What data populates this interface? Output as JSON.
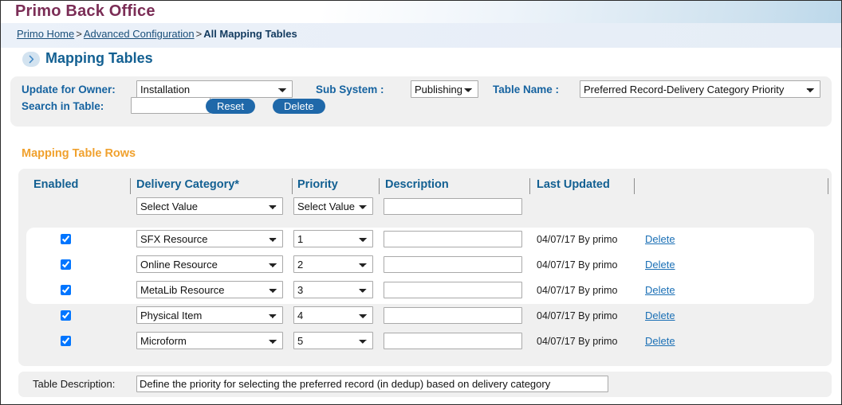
{
  "app": {
    "title": "Primo Back Office"
  },
  "breadcrumb": {
    "home": "Primo Home",
    "sep1": ">",
    "parent": "Advanced Configuration",
    "sep2": ">",
    "current": "All Mapping Tables"
  },
  "page": {
    "title": "Mapping Tables",
    "chevron_icon": "chevron-right-icon"
  },
  "filters": {
    "owner_label": "Update for Owner:",
    "owner_value": "Installation",
    "subsystem_label": "Sub System :",
    "subsystem_value": "Publishing",
    "table_label": "Table Name :",
    "table_value": "Preferred Record-Delivery Category Priority",
    "search_label": "Search in Table:",
    "search_value": "",
    "search_placeholder": "",
    "reset_button": "Reset",
    "delete_button": "Delete"
  },
  "grid": {
    "section_title": "Mapping Table Rows",
    "columns": [
      "Enabled",
      "Delivery Category*",
      "Priority",
      "Description",
      "Last Updated"
    ],
    "new_row": {
      "category_placeholder": "Select Value",
      "priority_placeholder": "Select Value",
      "description_value": ""
    },
    "row_action_label": "Delete",
    "rows": [
      {
        "enabled": true,
        "category": "SFX Resource",
        "priority": "1",
        "description": "",
        "last_updated": "04/07/17",
        "updated_by": "By primo",
        "action": "Delete"
      },
      {
        "enabled": true,
        "category": "Online Resource",
        "priority": "2",
        "description": "",
        "last_updated": "04/07/17",
        "updated_by": "By primo",
        "action": "Delete"
      },
      {
        "enabled": true,
        "category": "MetaLib Resource",
        "priority": "3",
        "description": "",
        "last_updated": "04/07/17",
        "updated_by": "By primo",
        "action": "Delete"
      },
      {
        "enabled": true,
        "category": "Physical Item",
        "priority": "4",
        "description": "",
        "last_updated": "04/07/17",
        "updated_by": "By primo",
        "action": "Delete"
      },
      {
        "enabled": true,
        "category": "Microform",
        "priority": "5",
        "description": "",
        "last_updated": "04/07/17",
        "updated_by": "By primo",
        "action": "Delete"
      }
    ]
  },
  "footer": {
    "description_label": "Table Description:",
    "description_value": "Define the priority for selecting the preferred record (in dedup) based on delivery category"
  },
  "colors": {
    "brand_maroon": "#7b2d56",
    "heading_blue": "#136092",
    "accent_orange": "#f0a12e",
    "button_blue": "#1f68a9",
    "link_blue": "#1a6fb5",
    "panel_grey": "#f0f0f0"
  }
}
